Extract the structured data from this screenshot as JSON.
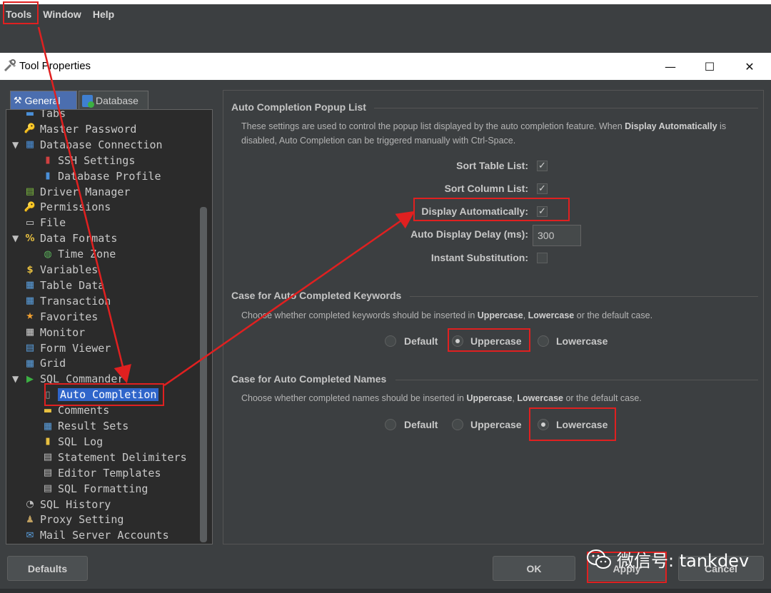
{
  "menubar": {
    "items": [
      "Tools",
      "Window",
      "Help"
    ]
  },
  "dialog": {
    "title": "Tool Properties"
  },
  "tabs": {
    "general": "General",
    "database": "Database"
  },
  "tree": [
    {
      "label": "Tabs",
      "indent": 1,
      "icon": "tabs-icon"
    },
    {
      "label": "Master Password",
      "indent": 1,
      "icon": "key-icon"
    },
    {
      "label": "Database Connection",
      "indent": 1,
      "icon": "database-connection-icon",
      "expanded": true
    },
    {
      "label": "SSH Settings",
      "indent": 2,
      "icon": "ssh-icon"
    },
    {
      "label": "Database Profile",
      "indent": 2,
      "icon": "profile-icon"
    },
    {
      "label": "Driver Manager",
      "indent": 1,
      "icon": "driver-icon"
    },
    {
      "label": "Permissions",
      "indent": 1,
      "icon": "permissions-key-icon"
    },
    {
      "label": "File",
      "indent": 1,
      "icon": "file-icon"
    },
    {
      "label": "Data Formats",
      "indent": 1,
      "icon": "percent-icon",
      "expanded": true
    },
    {
      "label": "Time Zone",
      "indent": 2,
      "icon": "globe-icon"
    },
    {
      "label": "Variables",
      "indent": 1,
      "icon": "dollar-icon"
    },
    {
      "label": "Table Data",
      "indent": 1,
      "icon": "table-icon"
    },
    {
      "label": "Transaction",
      "indent": 1,
      "icon": "transaction-icon"
    },
    {
      "label": "Favorites",
      "indent": 1,
      "icon": "star-icon"
    },
    {
      "label": "Monitor",
      "indent": 1,
      "icon": "monitor-icon"
    },
    {
      "label": "Form Viewer",
      "indent": 1,
      "icon": "form-icon"
    },
    {
      "label": "Grid",
      "indent": 1,
      "icon": "grid-icon"
    },
    {
      "label": "SQL Commander",
      "indent": 1,
      "icon": "play-icon",
      "expanded": true
    },
    {
      "label": "Auto Completion",
      "indent": 2,
      "icon": "auto-completion-icon",
      "selected": true
    },
    {
      "label": "Comments",
      "indent": 2,
      "icon": "folder-icon"
    },
    {
      "label": "Result Sets",
      "indent": 2,
      "icon": "result-sets-icon"
    },
    {
      "label": "SQL Log",
      "indent": 2,
      "icon": "log-icon"
    },
    {
      "label": "Statement Delimiters",
      "indent": 2,
      "icon": "delimiters-icon"
    },
    {
      "label": "Editor Templates",
      "indent": 2,
      "icon": "templates-icon"
    },
    {
      "label": "SQL Formatting",
      "indent": 2,
      "icon": "formatting-icon"
    },
    {
      "label": "SQL History",
      "indent": 1,
      "icon": "history-icon"
    },
    {
      "label": "Proxy Setting",
      "indent": 1,
      "icon": "proxy-icon"
    },
    {
      "label": "Mail Server Accounts",
      "indent": 1,
      "icon": "mail-icon"
    }
  ],
  "popup": {
    "title": "Auto Completion Popup List",
    "desc_parts": [
      "These settings are used to control the popup list displayed by the auto completion feature. When ",
      "Display Automatically",
      " is disabled, Auto Completion can be triggered manually with Ctrl-Space."
    ],
    "sort_table": "Sort Table List:",
    "sort_column": "Sort Column List:",
    "display_auto": "Display Automatically:",
    "delay_label": "Auto Display Delay (ms):",
    "delay_value": "300",
    "instant_sub": "Instant Substitution:",
    "checks": {
      "sort_table": true,
      "sort_column": true,
      "display_auto": true,
      "instant_sub": false
    }
  },
  "keywords": {
    "title": "Case for Auto Completed Keywords",
    "desc_parts": [
      "Choose whether completed keywords should be inserted in ",
      "Uppercase",
      ", ",
      "Lowercase",
      " or the default case."
    ],
    "options": [
      "Default",
      "Uppercase",
      "Lowercase"
    ],
    "selected": "Uppercase"
  },
  "names": {
    "title": "Case for Auto Completed Names",
    "desc_parts": [
      "Choose whether completed names should be inserted in ",
      "Uppercase",
      ", ",
      "Lowercase",
      " or the default case."
    ],
    "options": [
      "Default",
      "Uppercase",
      "Lowercase"
    ],
    "selected": "Lowercase"
  },
  "buttons": {
    "defaults": "Defaults",
    "ok": "OK",
    "apply": "Apply",
    "cancel": "Cancel"
  },
  "watermark": "微信号: tankdev",
  "colors": {
    "accent": "#2f65ca",
    "annotation": "#e02020",
    "background": "#3c3f41"
  }
}
